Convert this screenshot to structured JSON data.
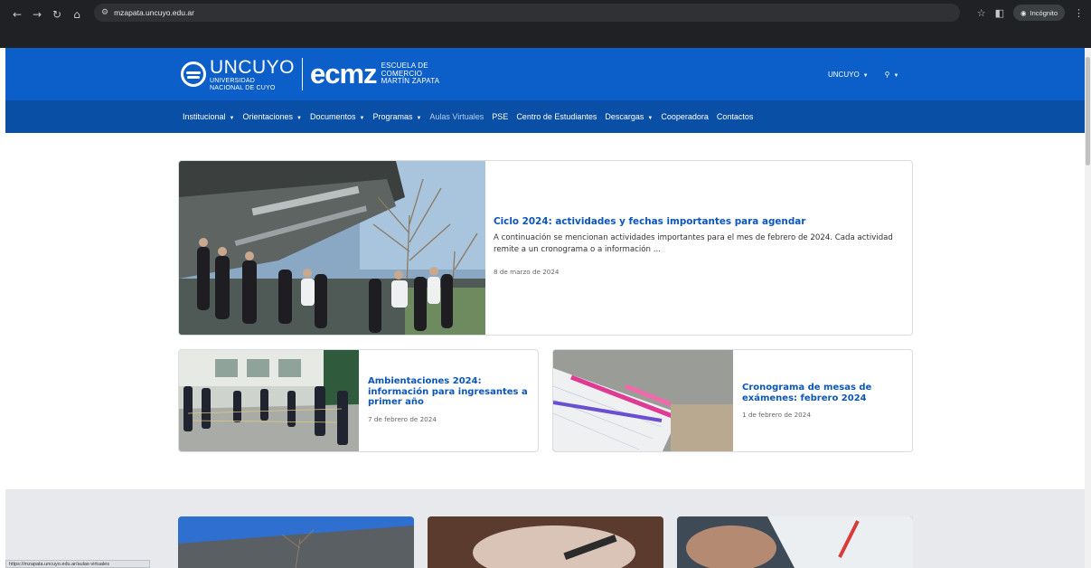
{
  "browser": {
    "url": "mzapata.uncuyo.edu.ar",
    "incognito_label": "Incógnito",
    "status_url": "https://mzapata.uncuyo.edu.ar/aulas-virtuales"
  },
  "header": {
    "uncuyo_name": "UNCUYO",
    "uncuyo_sub1": "UNIVERSIDAD",
    "uncuyo_sub2": "NACIONAL DE CUYO",
    "ecmz": "ecmz",
    "escuela_line1": "ESCUELA DE",
    "escuela_line2": "COMERCIO",
    "escuela_line3": "MARTÍN ZAPATA",
    "uncuyo_menu": "UNCUYO"
  },
  "nav": [
    {
      "label": "Institucional",
      "dropdown": true
    },
    {
      "label": "Orientaciones",
      "dropdown": true
    },
    {
      "label": "Documentos",
      "dropdown": true
    },
    {
      "label": "Programas",
      "dropdown": true
    },
    {
      "label": "Aulas Virtuales",
      "dropdown": false
    },
    {
      "label": "PSE",
      "dropdown": false
    },
    {
      "label": "Centro de Estudiantes",
      "dropdown": false
    },
    {
      "label": "Descargas",
      "dropdown": true
    },
    {
      "label": "Cooperadora",
      "dropdown": false
    },
    {
      "label": "Contactos",
      "dropdown": false
    }
  ],
  "featured": {
    "title": "Ciclo 2024: actividades y fechas importantes para agendar",
    "excerpt": "A continuación se mencionan actividades importantes para el mes de febrero de 2024. Cada actividad remite a un cronograma o a información ...",
    "date": "8 de marzo de 2024"
  },
  "cards": [
    {
      "title": "Ambientaciones 2024: información para ingresantes a primer año",
      "date": "7 de febrero de 2024"
    },
    {
      "title": "Cronograma de mesas de exámenes: febrero 2024",
      "date": "1 de febrero de 2024"
    }
  ],
  "colors": {
    "brand_blue": "#0c5fc9",
    "nav_blue": "#0a4fa6",
    "link_blue": "#0b56b8"
  }
}
